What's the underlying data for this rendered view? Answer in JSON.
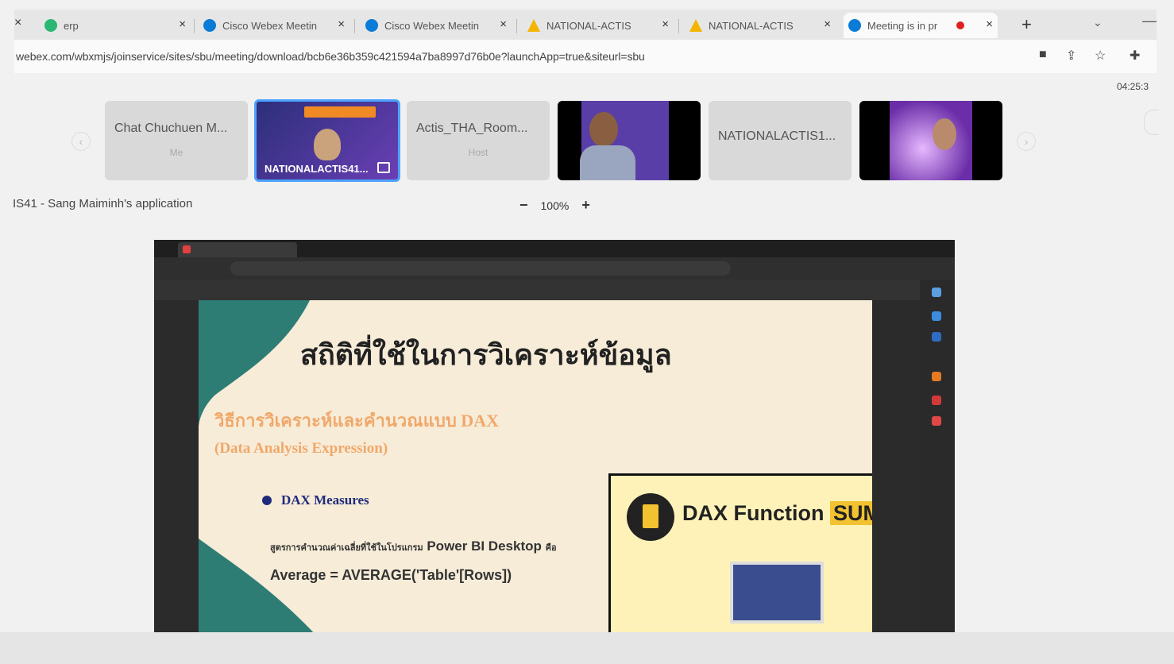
{
  "browser": {
    "tabs": [
      {
        "title": "erp",
        "icon_color": "#2bb673"
      },
      {
        "title": "Cisco Webex Meetin",
        "icon_color": "#0a7bd6"
      },
      {
        "title": "Cisco Webex Meetin",
        "icon_color": "#0a7bd6"
      },
      {
        "title": "NATIONAL-ACTIS",
        "icon_color": "#f4b400"
      },
      {
        "title": "NATIONAL-ACTIS",
        "icon_color": "#f4b400"
      },
      {
        "title": "Meeting is in pr",
        "icon_color": "#0a7bd6",
        "active": true,
        "recording": true
      }
    ],
    "close_glyph": "×",
    "new_tab_glyph": "+",
    "url": "webex.com/wbxmjs/joinservice/sites/sbu/meeting/download/bcb6e36b359c421594a7ba8997d76b0e?launchApp=true&siteurl=sbu"
  },
  "meeting": {
    "time": "04:25:3",
    "participants": [
      {
        "name": "Chat Chuchuen M...",
        "role": "Me",
        "kind": "avatar"
      },
      {
        "name": "NATIONALACTIS41...",
        "role": "",
        "kind": "active"
      },
      {
        "name": "Actis_THA_Room...",
        "role": "Host",
        "kind": "avatar"
      },
      {
        "name": "",
        "role": "",
        "kind": "video"
      },
      {
        "name": "NATIONALACTIS1...",
        "role": "",
        "kind": "avatar"
      },
      {
        "name": "",
        "role": "",
        "kind": "video"
      }
    ],
    "share_title": "IS41 - Sang Maiminh's application",
    "zoom": "100%",
    "zoom_minus": "−",
    "zoom_plus": "+"
  },
  "slide": {
    "title": "สถิติที่ใช้ในการวิเคราะห์ข้อมูล",
    "subtitle": "วิธีการวิเคราะห์และคำนวณแบบ DAX",
    "subtitle2": "(Data Analysis Expression)",
    "bullet": "DAX Measures",
    "formula_prefix": "สูตรการคำนวณค่าเฉลี่ยที่ใช้ในโปรแกรม",
    "formula_app": "Power BI Desktop",
    "formula_suffix": "คือ",
    "formula": "Average = AVERAGE('Table'[Rows])",
    "card_title": "DAX Function",
    "card_highlight": "SUM"
  }
}
